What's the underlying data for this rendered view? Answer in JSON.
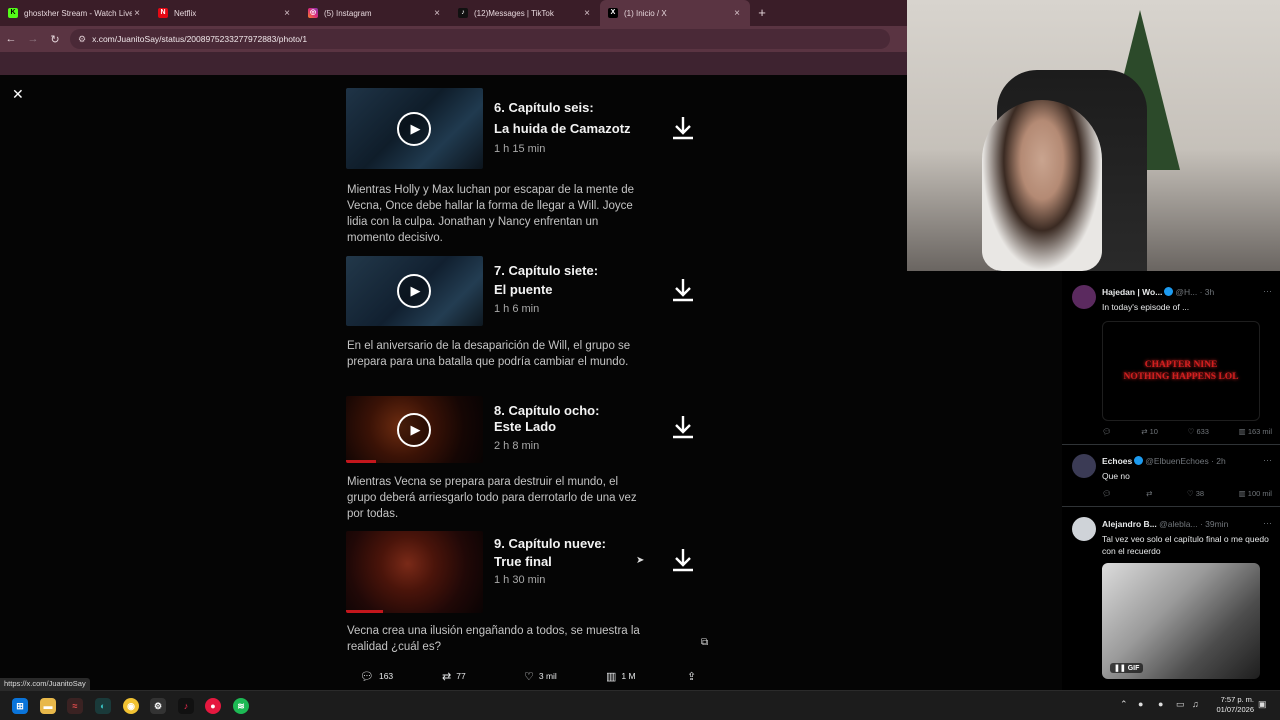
{
  "browser": {
    "tabs": [
      {
        "title": "ghostxher Stream - Watch Live",
        "icon": "kick-icon",
        "color": "#53fc18"
      },
      {
        "title": "Netflix",
        "icon": "netflix-icon",
        "color": "#e50914"
      },
      {
        "title": "(5) Instagram",
        "icon": "instagram-icon",
        "color": "#d6249f"
      },
      {
        "title": "(12)Messages | TikTok",
        "icon": "tiktok-icon",
        "color": "#111111"
      },
      {
        "title": "(1) Inicio / X",
        "icon": "x-icon",
        "color": "#000000"
      }
    ],
    "new_tab": "+",
    "url": "x.com/JuanitoSay/status/2008975233277972883/photo/1",
    "status_url": "https://x.com/JuanitoSay"
  },
  "episodes": [
    {
      "title1": "6. Capítulo seis:",
      "title2": "La huida de Camazotz",
      "duration": "1 h 15 min",
      "description": "Mientras Holly y Max luchan por escapar de la mente de Vecna, Once debe hallar la forma de llegar a Will. Joyce lidia con la culpa. Jonathan y Nancy enfrentan un momento decisivo.",
      "progress": 0
    },
    {
      "title1": "7. Capítulo siete:",
      "title2": "El puente",
      "duration": "1 h 6 min",
      "description": "En el aniversario de la desaparición de Will, el grupo se prepara para una batalla que podría cambiar el mundo.",
      "progress": 0
    },
    {
      "title1": "8. Capítulo ocho:",
      "title2": "Este Lado",
      "duration": "2 h 8 min",
      "description": "Mientras Vecna se prepara para destruir el mundo, el grupo deberá arriesgarlo todo para derrotarlo de una vez por todas.",
      "progress": 0.22
    },
    {
      "title1": "9. Capítulo nueve:",
      "title2": "True final",
      "duration": "1 h 30 min",
      "description": "Vecna crea una ilusión engañando a todos, se muestra la realidad ¿cuál es?",
      "progress": 0.27
    }
  ],
  "post_actions": {
    "replies": "163",
    "reposts": "77",
    "likes": "3 mil",
    "views": "1 M"
  },
  "feed": [
    {
      "name": "Hajedan | Wo...",
      "handle": "@H...",
      "time": "· 3h",
      "text": "In today's episode of ...",
      "media_line1": "CHAPTER NINE",
      "media_line2": "NOTHING HAPPENS LOL",
      "replies": "",
      "reposts": "10",
      "likes": "633",
      "views": "163 mil"
    },
    {
      "name": "Echoes",
      "handle": "@ElbuenEchoes",
      "time": "· 2h",
      "text": "Que no",
      "replies": "",
      "reposts": "",
      "likes": "38",
      "views": "100 mil"
    },
    {
      "name": "Alejandro B...",
      "handle": "@alebla...",
      "time": "· 39min",
      "text": "Tal vez veo solo el capítulo final o me quedo con el recuerdo",
      "media_badge": "GIF"
    }
  ],
  "clock": {
    "time": "7:57 p. m.",
    "date": "01/07/2026"
  }
}
